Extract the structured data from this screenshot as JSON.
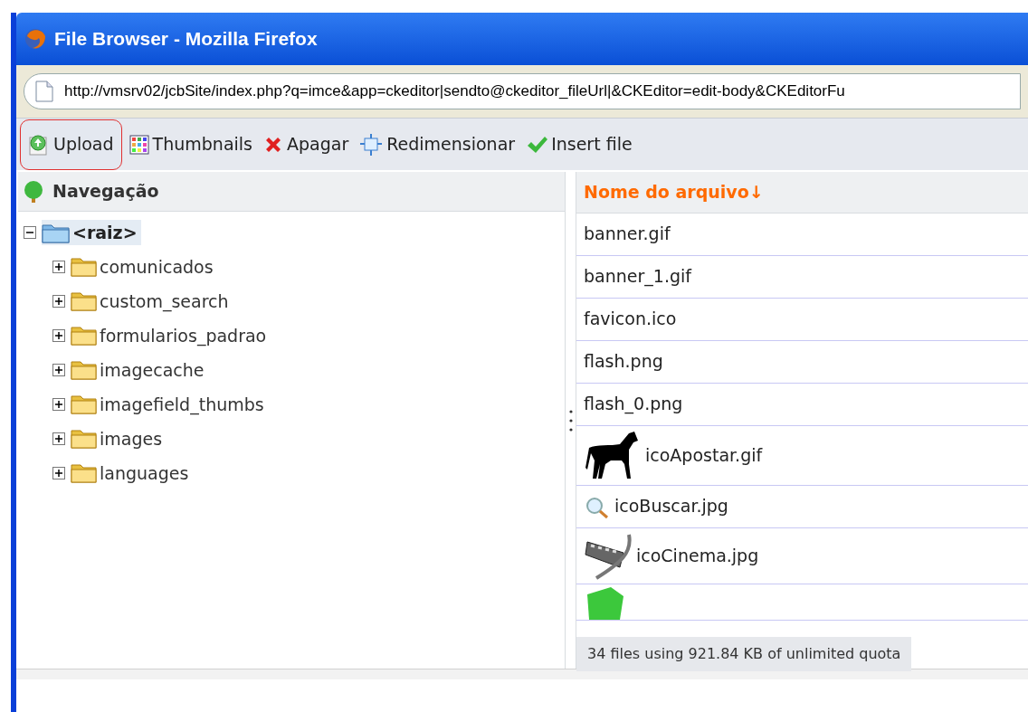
{
  "window": {
    "title": "File Browser - Mozilla Firefox"
  },
  "address_bar": {
    "url": "http://vmsrv02/jcbSite/index.php?q=imce&app=ckeditor|sendto@ckeditor_fileUrl|&CKEditor=edit-body&CKEditorFu"
  },
  "toolbar": [
    {
      "kind": "upload",
      "label": "Upload",
      "selected": true
    },
    {
      "kind": "thumbnails",
      "label": "Thumbnails",
      "selected": false
    },
    {
      "kind": "delete",
      "label": "Apagar",
      "selected": false
    },
    {
      "kind": "resize",
      "label": "Redimensionar",
      "selected": false
    },
    {
      "kind": "insert",
      "label": "Insert file",
      "selected": false
    }
  ],
  "navigation": {
    "title": "Navegação",
    "tree": [
      {
        "label": "<raiz>",
        "expanded": true,
        "selected": true,
        "children": [
          {
            "label": "comunicados",
            "expanded": false,
            "selected": false
          },
          {
            "label": "custom_search",
            "expanded": false,
            "selected": false
          },
          {
            "label": "formularios_padrao",
            "expanded": false,
            "selected": false
          },
          {
            "label": "imagecache",
            "expanded": false,
            "selected": false
          },
          {
            "label": "imagefield_thumbs",
            "expanded": false,
            "selected": false
          },
          {
            "label": "images",
            "expanded": false,
            "selected": false
          },
          {
            "label": "languages",
            "expanded": false,
            "selected": false
          }
        ]
      }
    ]
  },
  "files": {
    "column": "Nome do arquivo↓",
    "rows": [
      {
        "name": "banner.gif"
      },
      {
        "name": "banner_1.gif"
      },
      {
        "name": "favicon.ico"
      },
      {
        "name": "flash.png"
      },
      {
        "name": "flash_0.png"
      },
      {
        "name": "icoApostar.gif",
        "kind": "horse"
      },
      {
        "name": "icoBuscar.jpg",
        "kind": "magnifier"
      },
      {
        "name": "icoCinema.jpg",
        "kind": "film"
      },
      {
        "kind": "box"
      }
    ],
    "status": "34 files using 921.84 KB of unlimited quota"
  }
}
